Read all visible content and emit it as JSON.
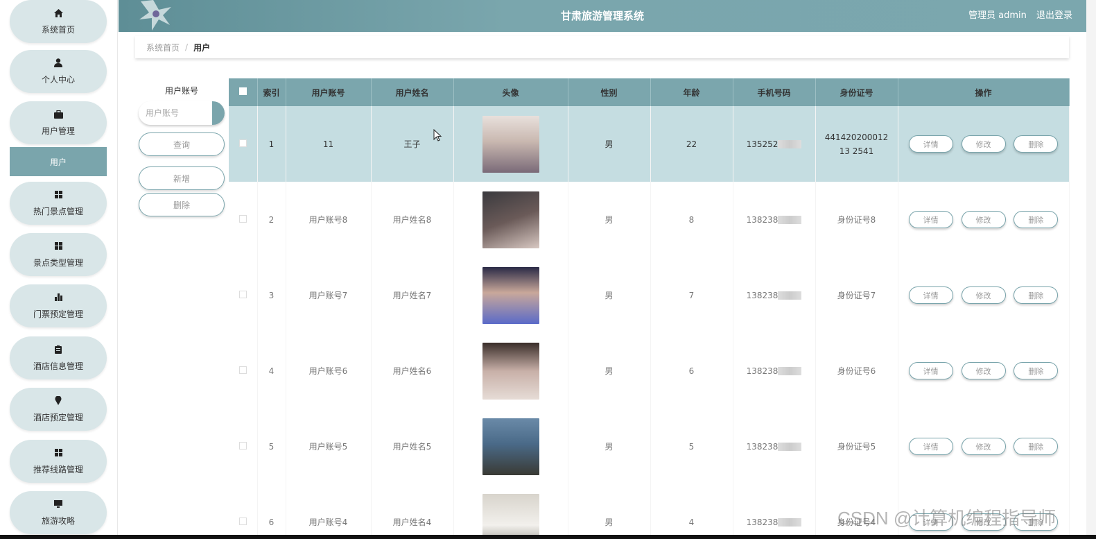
{
  "header": {
    "title": "甘肃旅游管理系统",
    "user_label": "管理员 admin",
    "logout": "退出登录"
  },
  "sidebar": {
    "items": [
      {
        "label": "系统首页",
        "icon": "home-icon"
      },
      {
        "label": "个人中心",
        "icon": "user-icon"
      },
      {
        "label": "用户管理",
        "icon": "briefcase-icon"
      },
      {
        "label": "热门景点管理",
        "icon": "grid-icon"
      },
      {
        "label": "景点类型管理",
        "icon": "grid-icon"
      },
      {
        "label": "门票预定管理",
        "icon": "bar-chart-icon"
      },
      {
        "label": "酒店信息管理",
        "icon": "clipboard-icon"
      },
      {
        "label": "酒店预定管理",
        "icon": "map-pin-icon"
      },
      {
        "label": "推荐线路管理",
        "icon": "grid-icon"
      },
      {
        "label": "旅游攻略",
        "icon": "monitor-icon"
      }
    ],
    "sub_active": "用户"
  },
  "breadcrumb": {
    "home": "系统首页",
    "sep": "/",
    "current": "用户"
  },
  "search": {
    "label": "用户账号",
    "placeholder": "用户账号",
    "query_btn": "查询",
    "add_btn": "新增",
    "delete_btn": "删除"
  },
  "table": {
    "headers": [
      "索引",
      "用户账号",
      "用户姓名",
      "头像",
      "性别",
      "年龄",
      "手机号码",
      "身份证号",
      "操作"
    ],
    "actions": {
      "detail": "详情",
      "edit": "修改",
      "delete": "删除"
    },
    "rows": [
      {
        "index": "1",
        "account": "11",
        "name": "王子",
        "gender": "男",
        "age": "22",
        "phone": "135252",
        "idcard": "44142020001213 2541"
      },
      {
        "index": "2",
        "account": "用户账号8",
        "name": "用户姓名8",
        "gender": "男",
        "age": "8",
        "phone": "138238",
        "idcard": "身份证号8"
      },
      {
        "index": "3",
        "account": "用户账号7",
        "name": "用户姓名7",
        "gender": "男",
        "age": "7",
        "phone": "138238",
        "idcard": "身份证号7"
      },
      {
        "index": "4",
        "account": "用户账号6",
        "name": "用户姓名6",
        "gender": "男",
        "age": "6",
        "phone": "138238",
        "idcard": "身份证号6"
      },
      {
        "index": "5",
        "account": "用户账号5",
        "name": "用户姓名5",
        "gender": "男",
        "age": "5",
        "phone": "138238",
        "idcard": "身份证号5"
      },
      {
        "index": "6",
        "account": "用户账号4",
        "name": "用户姓名4",
        "gender": "男",
        "age": "4",
        "phone": "138238",
        "idcard": "身份证号4"
      }
    ]
  },
  "watermark": "CSDN @计算机编程指导师",
  "colors": {
    "accent": "#7aa5ac",
    "header": "#7ba6ad",
    "nav_bg": "#d9e6e8",
    "row_highlight": "#c5dde1"
  }
}
